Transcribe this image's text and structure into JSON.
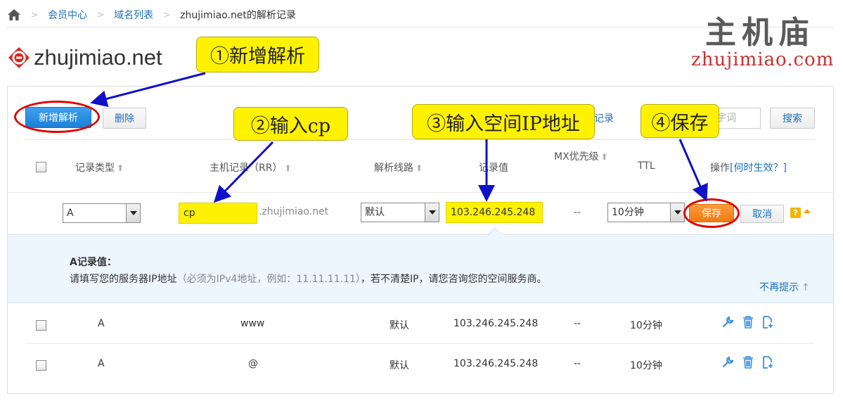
{
  "breadcrumb": {
    "items": [
      "会员中心",
      "域名列表",
      "zhujimiao.net的解析记录"
    ]
  },
  "watermark": {
    "cn": "主机庙",
    "en": "zhujimiao.com"
  },
  "domain": {
    "name": "zhujimiao.net"
  },
  "toolbar": {
    "add_label": "新增解析",
    "delete_label": "删除",
    "records_link": "记录",
    "search_placeholder": "字词",
    "search_label": "搜索"
  },
  "table": {
    "headers": {
      "type": "记录类型",
      "host": "主机记录（RR）",
      "line": "解析线路",
      "value": "记录值",
      "mx": "MX优先级",
      "ttl": "TTL",
      "ops": "操作",
      "ops_link": "[何时生效？]"
    },
    "edit_row": {
      "type": "A",
      "host": "cp",
      "suffix": ".zhujimiao.net",
      "line": "默认",
      "value": "103.246.245.248",
      "mx": "--",
      "ttl": "10分钟",
      "save_label": "保存",
      "cancel_label": "取消",
      "help": "?"
    },
    "tip": {
      "title": "A记录值：",
      "body": "请填写您的服务器IP地址",
      "hint": "（必须为IPv4地址，例如：11.11.11.11）",
      "body_tail": "，若不清楚IP，请您咨询您的空间服务商。",
      "dismiss": "不再提示"
    },
    "rows": [
      {
        "type": "A",
        "host": "www",
        "line": "默认",
        "value": "103.246.245.248",
        "mx": "--",
        "ttl": "10分钟"
      },
      {
        "type": "A",
        "host": "@",
        "line": "默认",
        "value": "103.246.245.248",
        "mx": "--",
        "ttl": "10分钟"
      }
    ]
  },
  "annotations": {
    "step1": "①新增解析",
    "step2": "②输入cp",
    "step3": "③输入空间IP地址",
    "step4": "④保存"
  },
  "colors": {
    "accent": "#1a6fbf",
    "highlight": "#fff200",
    "ring": "#e00000",
    "arrow": "#1010c8",
    "save": "#f07a12"
  }
}
